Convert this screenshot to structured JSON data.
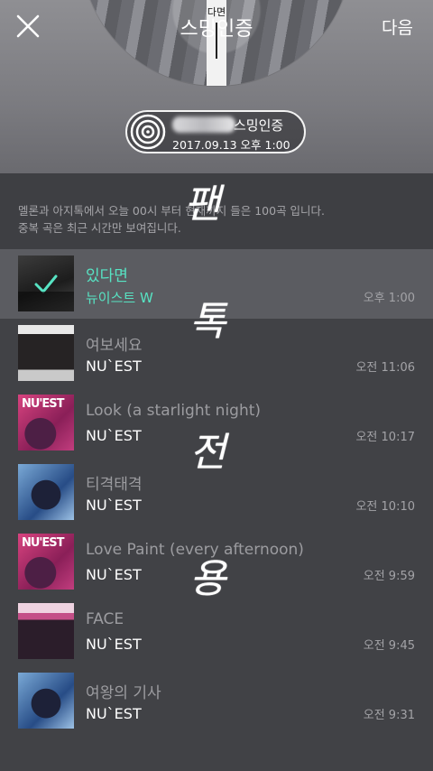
{
  "header": {
    "title": "스밍인증",
    "next_label": "다음",
    "bookmark_text": "다면"
  },
  "badge": {
    "label": "스밍인증",
    "date": "2017.09.13 오후 1:00"
  },
  "info": {
    "line1": "멜론과 아지톡에서 오늘 00시 부터 현재까지 들은 100곡 입니다.",
    "line2": "중복 곡은 최근 시간만 보여집니다."
  },
  "songs": [
    {
      "title": "있다면",
      "artist": "뉴이스트 W",
      "time": "오후 1:00",
      "selected": true,
      "art": "art-bw"
    },
    {
      "title": "여보세요",
      "artist": "NU`EST",
      "time": "오전 11:06",
      "selected": false,
      "art": "art-dark"
    },
    {
      "title": "Look (a starlight night)",
      "artist": "NU`EST",
      "time": "오전 10:17",
      "selected": false,
      "art": "art-pink",
      "brand": "NU'EST"
    },
    {
      "title": "티격태격",
      "artist": "NU`EST",
      "time": "오전 10:10",
      "selected": false,
      "art": "art-blue"
    },
    {
      "title": "Love Paint (every afternoon)",
      "artist": "NU`EST",
      "time": "오전 9:59",
      "selected": false,
      "art": "art-pink",
      "brand": "NU'EST"
    },
    {
      "title": "FACE",
      "artist": "NU`EST",
      "time": "오전 9:45",
      "selected": false,
      "art": "art-face"
    },
    {
      "title": "여왕의 기사",
      "artist": "NU`EST",
      "time": "오전 9:31",
      "selected": false,
      "art": "art-blue"
    }
  ],
  "handwriting": [
    "팬",
    "톡",
    "전",
    "용"
  ],
  "colors": {
    "accent": "#57e3c3",
    "background": "#414246",
    "selected_row": "#5b5c61"
  }
}
